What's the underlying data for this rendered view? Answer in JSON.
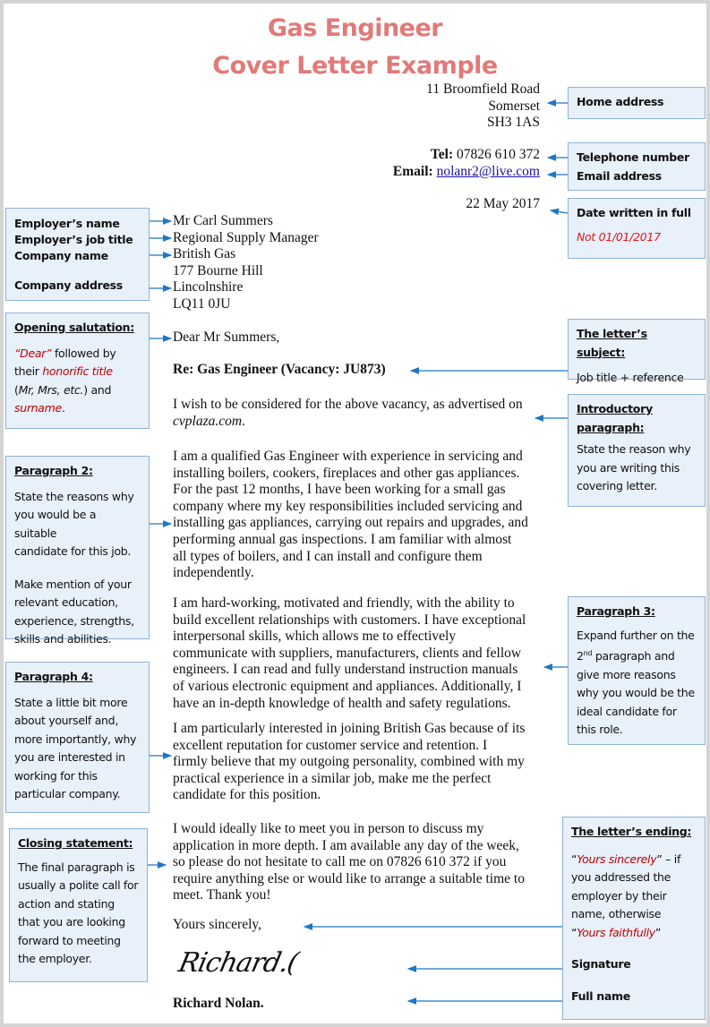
{
  "title": {
    "line1": "Gas Engineer",
    "line2": "Cover Letter Example"
  },
  "sender": {
    "address": [
      "11 Broomfield Road",
      "Somerset",
      "SH3 1AS"
    ],
    "tel_label": "Tel:",
    "tel": "07826 610 372",
    "email_label": "Email:",
    "email": "nolanr2@live.com",
    "date": "22 May 2017"
  },
  "recipient": {
    "name": "Mr Carl Summers",
    "job_title": "Regional Supply Manager",
    "company": "British Gas",
    "address": [
      "177 Bourne Hill",
      "Lincolnshire",
      "LQ11 0JU"
    ]
  },
  "letter": {
    "salutation": "Dear Mr Summers,",
    "subject": "Re: Gas Engineer (Vacancy: JU873)",
    "intro_text": "I wish to be considered for the above vacancy, as advertised on",
    "intro_site": "cvplaza.com",
    "intro_end": ".",
    "paragraph2": [
      "I am a qualified Gas Engineer with experience in servicing and",
      "installing boilers, cookers, fireplaces and other gas appliances.",
      "For the past 12 months, I have been working for a small gas",
      "company where my key responsibilities included servicing and",
      "installing gas appliances, carrying out repairs and upgrades, and",
      "performing annual gas inspections. I am familiar with almost",
      "all types of boilers, and I can install and configure them",
      "independently."
    ],
    "paragraph3": [
      "I am hard-working, motivated and friendly, with the ability to",
      "build excellent relationships with customers. I have exceptional",
      "interpersonal skills, which allows me to effectively",
      "communicate with suppliers, manufacturers, clients and fellow",
      "engineers. I can read and fully understand instruction manuals",
      "of various electronic equipment and appliances.  Additionally, I",
      "have an in-depth knowledge of health and safety regulations."
    ],
    "paragraph4": [
      "I am particularly interested in joining British Gas because of its",
      "excellent reputation for customer service and retention.  I",
      "firmly believe that my outgoing personality, combined with my",
      "practical experience in a similar job, make me the perfect",
      "candidate for this position."
    ],
    "closing": [
      "I would ideally like to meet you in person to discuss my",
      "application in more depth. I am available any day of the week,",
      "so please do not hesitate to call me on 07826 610 372 if you",
      "require anything else or would like to arrange a suitable time to",
      "meet. Thank you!"
    ],
    "sign_off": "Yours sincerely,",
    "signature": "Richard.(",
    "full_name": "Richard Nolan."
  },
  "annotations": {
    "home_address": "Home address",
    "telephone": "Telephone number",
    "email": "Email address",
    "date_title": "Date written in full",
    "date_note": "Not 01/01/2017",
    "employer_name": "Employer’s name",
    "employer_job_title": "Employer’s job title",
    "company_name": "Company name",
    "company_address": "Company address",
    "opening": {
      "title": "Opening salutation:",
      "dear": "“Dear”",
      "t1": " followed by",
      "t2": "their ",
      "honorific": "honorific title",
      "t3a": "(",
      "mr": "Mr, Mrs, etc.",
      "t3b": ") and",
      "surname": "surname",
      "t4": "."
    },
    "subject": {
      "title": "The letter’s subject:",
      "text": "Job title + reference"
    },
    "intro": {
      "title1": "Introductory",
      "title2": "paragraph:",
      "lines": [
        "State the reason why",
        "you are writing this",
        "covering letter."
      ]
    },
    "para2": {
      "title": "Paragraph 2:",
      "lines": [
        "State the reasons why",
        "you would be a suitable",
        "candidate for this job."
      ],
      "lines2": [
        "Make mention of your",
        "relevant education,",
        "experience, strengths,",
        "skills and abilities."
      ]
    },
    "para3": {
      "title": "Paragraph 3:",
      "l1": "Expand further on the",
      "l2_num": "2",
      "l2_sup": "nd",
      "l2_rest": " paragraph and",
      "lines": [
        "give more reasons",
        "why you would be the",
        "ideal candidate for",
        "this role."
      ]
    },
    "para4": {
      "title": "Paragraph 4:",
      "lines": [
        "State a little bit more",
        "about yourself and,",
        "more importantly, why",
        "you are interested in",
        "working for this",
        "particular company."
      ]
    },
    "closing": {
      "title": "Closing statement:",
      "lines": [
        "The final paragraph is",
        "usually a polite call for",
        "action and stating",
        "that you are looking",
        "forward to meeting",
        "the employer."
      ]
    },
    "ending": {
      "title": "The letter’s ending:",
      "q1": "“",
      "sincerely": "Yours sincerely",
      "q2": "” – if",
      "lines": [
        "you addressed the",
        "employer by their",
        "name, otherwise"
      ],
      "q3": "“",
      "faithfully": "Yours faithfully",
      "q4": "”",
      "signature": "Signature",
      "full_name": "Full name"
    }
  },
  "colors": {
    "title": "#e07a78",
    "arrow": "#1f77c4",
    "box_bg": "#e8f0fa",
    "box_border": "#8fb2d9",
    "emphasis_red": "#c00000"
  }
}
